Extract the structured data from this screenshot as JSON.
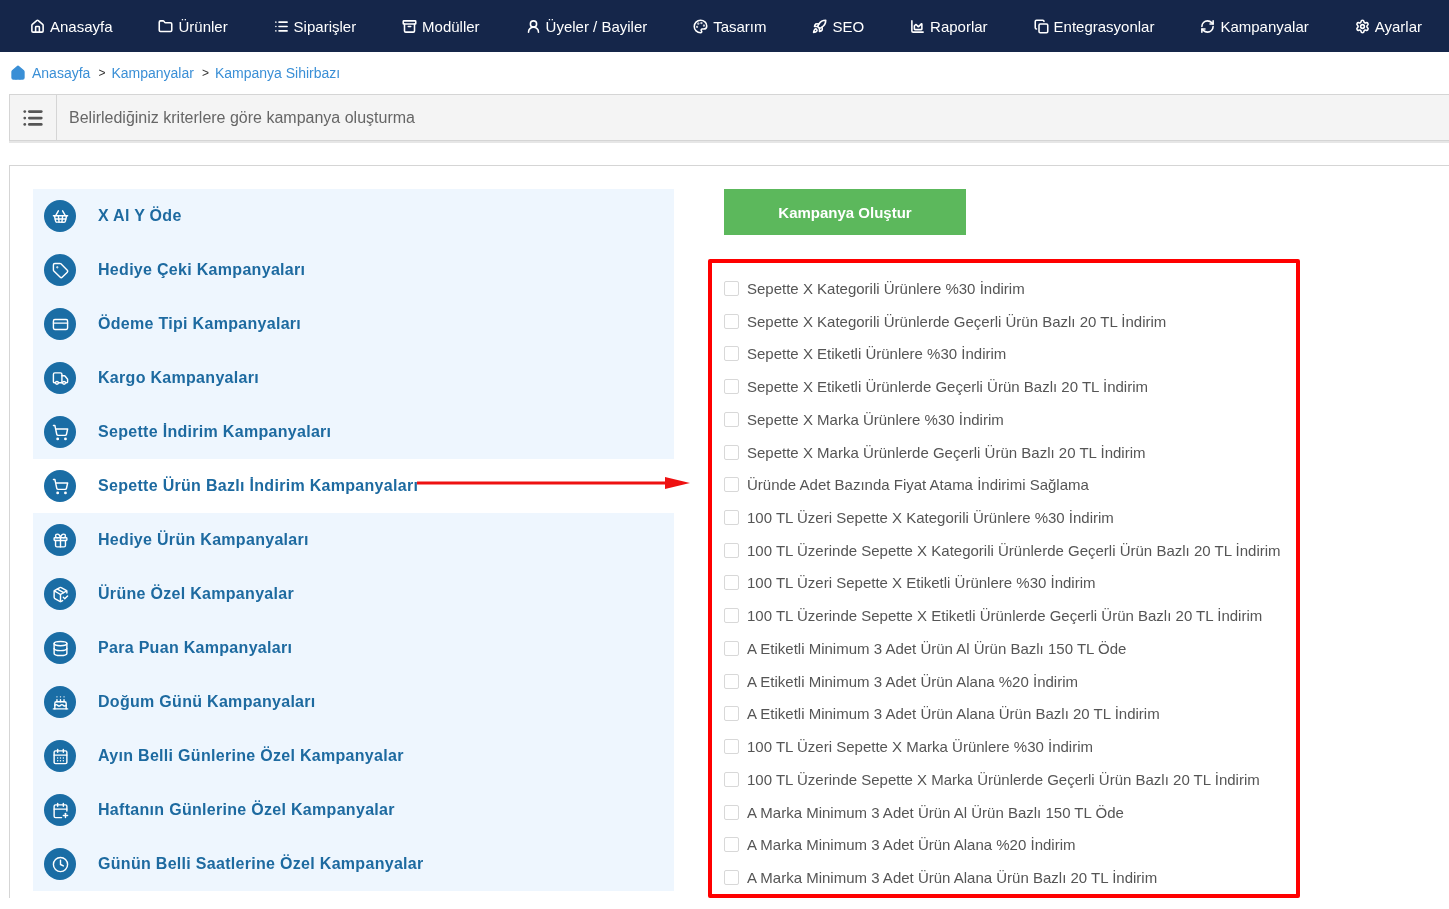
{
  "nav": [
    {
      "label": "Anasayfa"
    },
    {
      "label": "Ürünler"
    },
    {
      "label": "Siparişler"
    },
    {
      "label": "Modüller"
    },
    {
      "label": "Üyeler / Bayiler"
    },
    {
      "label": "Tasarım"
    },
    {
      "label": "SEO"
    },
    {
      "label": "Raporlar"
    },
    {
      "label": "Entegrasyonlar"
    },
    {
      "label": "Kampanyalar"
    },
    {
      "label": "Ayarlar"
    }
  ],
  "breadcrumb": [
    {
      "label": "Anasayfa"
    },
    {
      "label": "Kampanyalar",
      "separator": ">"
    },
    {
      "label": "Kampanya Sihirbazı",
      "separator": ">"
    }
  ],
  "header": {
    "title": "Belirlediğiniz kriterlere göre kampanya oluşturma"
  },
  "campaign_types": [
    {
      "label": "X Al Y Öde",
      "selected": false
    },
    {
      "label": "Hediye Çeki Kampanyaları",
      "selected": false
    },
    {
      "label": "Ödeme Tipi Kampanyaları",
      "selected": false
    },
    {
      "label": "Kargo Kampanyaları",
      "selected": false
    },
    {
      "label": "Sepette İndirim Kampanyaları",
      "selected": false
    },
    {
      "label": "Sepette Ürün Bazlı İndirim Kampanyaları",
      "selected": true
    },
    {
      "label": "Hediye Ürün Kampanyaları",
      "selected": false
    },
    {
      "label": "Ürüne Özel Kampanyalar",
      "selected": false
    },
    {
      "label": "Para Puan Kampanyaları",
      "selected": false
    },
    {
      "label": "Doğum Günü Kampanyaları",
      "selected": false
    },
    {
      "label": "Ayın Belli Günlerine Özel Kampanyalar",
      "selected": false
    },
    {
      "label": "Haftanın Günlerine Özel Kampanyalar",
      "selected": false
    },
    {
      "label": "Günün Belli Saatlerine Özel Kampanyalar",
      "selected": false
    }
  ],
  "create_button": "Kampanya Oluştur",
  "options": [
    {
      "label": "Sepette X Kategorili Ürünlere %30 İndirim",
      "checked": false
    },
    {
      "label": "Sepette X Kategorili Ürünlerde Geçerli Ürün Bazlı 20 TL İndirim",
      "checked": false
    },
    {
      "label": "Sepette X Etiketli Ürünlere %30 İndirim",
      "checked": false
    },
    {
      "label": "Sepette X Etiketli Ürünlerde Geçerli Ürün Bazlı 20 TL İndirim",
      "checked": false
    },
    {
      "label": "Sepette X Marka Ürünlere %30 İndirim",
      "checked": false
    },
    {
      "label": "Sepette X Marka Ürünlerde Geçerli Ürün Bazlı 20 TL İndirim",
      "checked": false
    },
    {
      "label": "Üründe Adet Bazında Fiyat Atama İndirimi Sağlama",
      "checked": false
    },
    {
      "label": "100 TL Üzeri Sepette X Kategorili Ürünlere %30 İndirim",
      "checked": false
    },
    {
      "label": "100 TL Üzerinde Sepette X Kategorili Ürünlerde Geçerli Ürün Bazlı 20 TL İndirim",
      "checked": false
    },
    {
      "label": "100 TL Üzeri Sepette X Etiketli Ürünlere %30 İndirim",
      "checked": false
    },
    {
      "label": "100 TL Üzerinde Sepette X Etiketli Ürünlerde Geçerli Ürün Bazlı 20 TL İndirim",
      "checked": false
    },
    {
      "label": "A Etiketli Minimum 3 Adet Ürün Al Ürün Bazlı 150 TL Öde",
      "checked": false
    },
    {
      "label": "A Etiketli Minimum 3 Adet Ürün Alana %20 İndirim",
      "checked": false
    },
    {
      "label": "A Etiketli Minimum 3 Adet Ürün Alana Ürün Bazlı 20 TL İndirim",
      "checked": false
    },
    {
      "label": "100 TL Üzeri Sepette X Marka Ürünlere %30 İndirim",
      "checked": false
    },
    {
      "label": "100 TL Üzerinde Sepette X Marka Ürünlerde Geçerli Ürün Bazlı 20 TL İndirim",
      "checked": false
    },
    {
      "label": "A Marka Minimum 3 Adet Ürün Al Ürün Bazlı 150 TL Öde",
      "checked": false
    },
    {
      "label": "A Marka Minimum 3 Adet Ürün Alana %20 İndirim",
      "checked": false
    },
    {
      "label": "A Marka Minimum 3 Adet Ürün Alana Ürün Bazlı 20 TL İndirim",
      "checked": false
    }
  ]
}
